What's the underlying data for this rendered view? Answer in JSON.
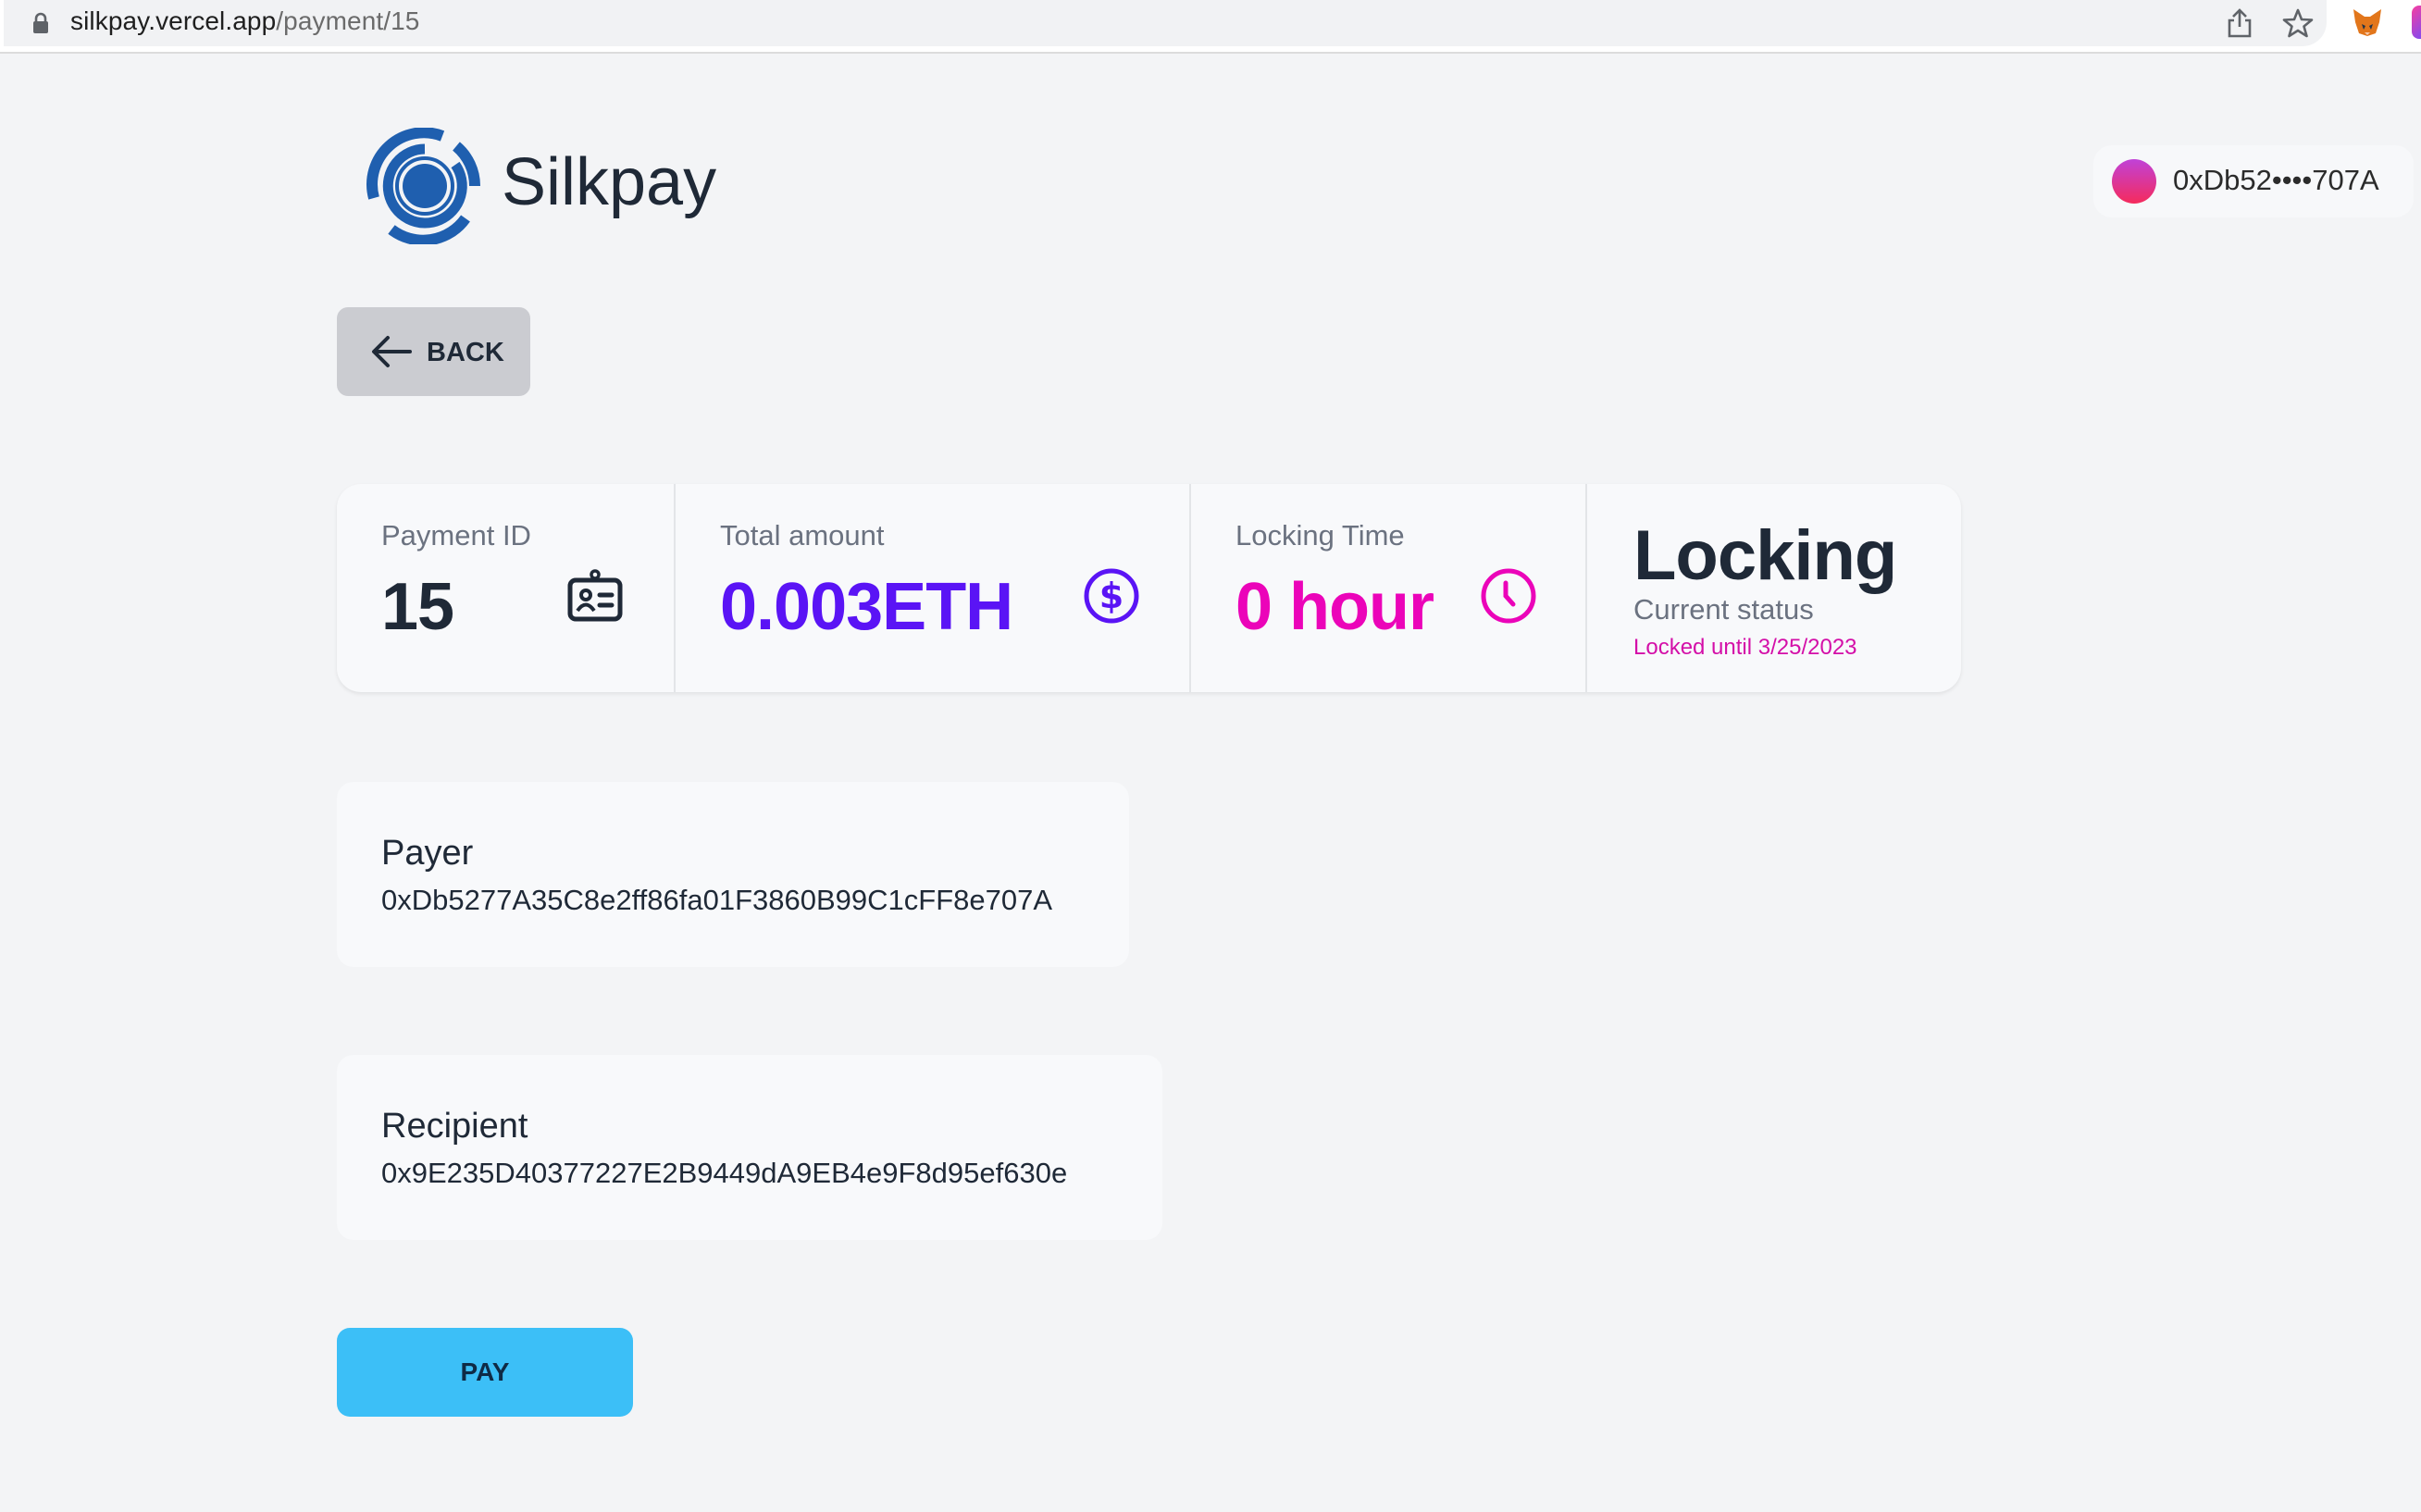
{
  "browser": {
    "url_host": "silkpay.vercel.app",
    "url_path": "/payment/15",
    "icons": [
      "lock-icon",
      "share-icon",
      "star-icon",
      "metamask-fox-icon",
      "extension-icon"
    ]
  },
  "header": {
    "brand": "Silkpay",
    "wallet": {
      "address_short": "0xDb52••••707A",
      "avatar_gradient": [
        "#c042d8",
        "#f52b5c"
      ]
    }
  },
  "back_button": {
    "label": "BACK",
    "icon": "arrow-left-icon"
  },
  "stats": {
    "payment_id": {
      "title": "Payment ID",
      "value": "15",
      "icon": "id-card-icon"
    },
    "total_amount": {
      "title": "Total amount",
      "value": "0.003ETH",
      "icon": "dollar-circle-icon",
      "color": "#5a14f5"
    },
    "locking_time": {
      "title": "Locking Time",
      "value": "0 hour",
      "icon": "clock-icon",
      "color": "#eb04b9"
    },
    "status": {
      "value": "Locking",
      "label": "Current status",
      "note": "Locked until 3/25/2023",
      "note_color": "#d40fa8"
    }
  },
  "payer": {
    "label": "Payer",
    "address": "0xDb5277A35C8e2ff86fa01F3860B99C1cFF8e707A"
  },
  "recipient": {
    "label": "Recipient",
    "address": "0x9E235D40377227E2B9449dA9EB4e9F8d95ef630e"
  },
  "pay_button": {
    "label": "PAY",
    "color": "#3cbff7"
  }
}
